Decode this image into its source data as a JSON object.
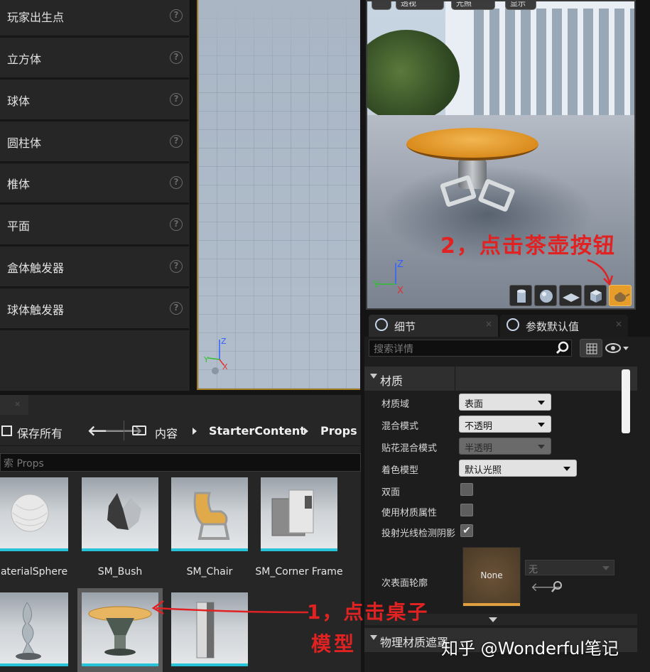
{
  "place_panel": {
    "items": [
      {
        "label": "玩家出生点"
      },
      {
        "label": "立方体"
      },
      {
        "label": "球体"
      },
      {
        "label": "圆柱体"
      },
      {
        "label": "椎体"
      },
      {
        "label": "平面"
      },
      {
        "label": "盒体触发器"
      },
      {
        "label": "球体触发器"
      }
    ],
    "help_glyph": "?"
  },
  "preview": {
    "top_buttons": [
      "",
      "透视",
      "光照",
      "显示"
    ],
    "annotation": "2，点击茶壶按钮",
    "axes": {
      "x": "X",
      "y": "Y",
      "z": "Z"
    },
    "shape_buttons": [
      "cylinder-icon",
      "sphere-icon",
      "plane-icon",
      "cube-icon",
      "teapot-icon"
    ],
    "active_shape": "teapot-icon"
  },
  "main_viewport": {
    "axes": {
      "x": "X",
      "y": "Y",
      "z": "Z"
    }
  },
  "details": {
    "tabs": [
      {
        "label": "细节",
        "close": "×"
      },
      {
        "label": "参数默认值",
        "close": "×"
      }
    ],
    "search_placeholder": "搜索详情",
    "section_title": "材质",
    "properties": [
      {
        "name": "材质域",
        "type": "combo",
        "value": "表面"
      },
      {
        "name": "混合模式",
        "type": "combo",
        "value": "不透明"
      },
      {
        "name": "贴花混合模式",
        "type": "combo",
        "value": "半透明",
        "disabled": true
      },
      {
        "name": "着色模型",
        "type": "combo",
        "value": "默认光照"
      },
      {
        "name": "双面",
        "type": "checkbox",
        "checked": false
      },
      {
        "name": "使用材质属性",
        "type": "checkbox",
        "checked": false
      },
      {
        "name": "投射光线检测阴影",
        "type": "checkbox",
        "checked": true
      }
    ],
    "subsurface": {
      "name": "次表面轮廓",
      "thumb_label": "None",
      "combo_value": "无"
    },
    "check_glyph": "✔",
    "section2_title": "物理材质遮罩",
    "watermark": "知乎 @Wonderful笔记"
  },
  "content_browser": {
    "tab_close": "×",
    "save_all": "保存所有",
    "nav_back": "🡐",
    "nav_forward": "🡒",
    "breadcrumbs": [
      "内容",
      "StarterContent",
      "Props"
    ],
    "search_placeholder": "索 Props",
    "assets": [
      {
        "name": "MaterialSphere"
      },
      {
        "name": "SM_Bush"
      },
      {
        "name": "SM_Chair"
      },
      {
        "name": "SM_Corner Frame"
      },
      {
        "name": ""
      },
      {
        "name": "",
        "selected": true
      },
      {
        "name": ""
      },
      {
        "name": ""
      }
    ],
    "annotation_line1": "1，点击桌子",
    "annotation_line2": "模型"
  },
  "colors": {
    "accent": "#e69d2a",
    "annotation": "#e02222",
    "asset_bar": "#27c3d9",
    "viewport_border": "#a27d1f"
  }
}
